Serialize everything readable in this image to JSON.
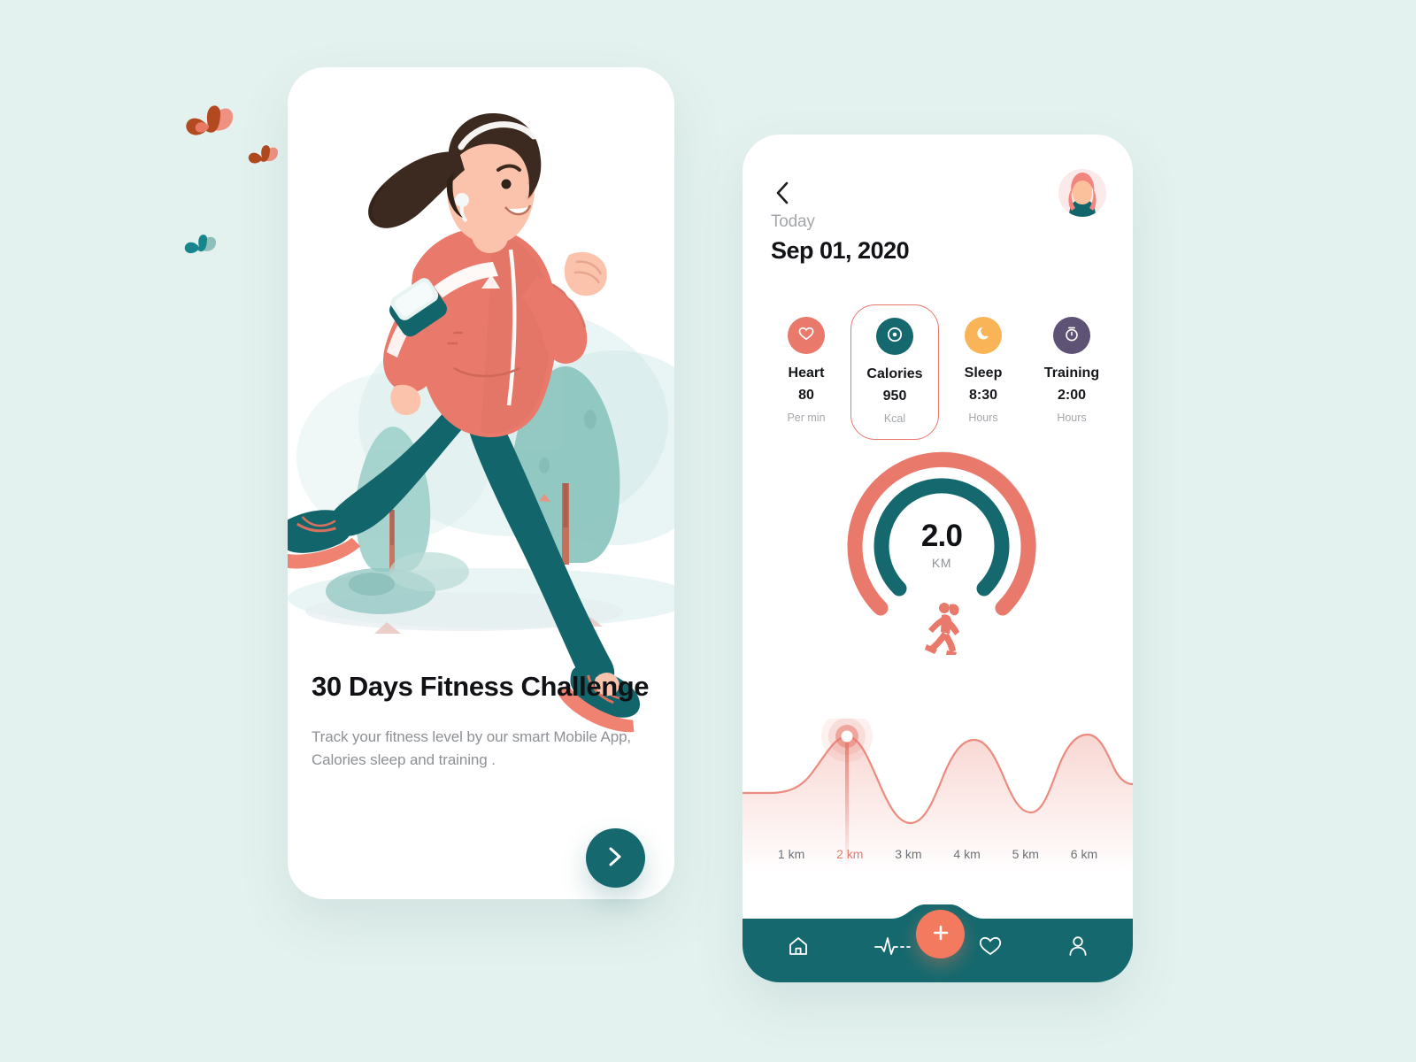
{
  "theme": {
    "bg": "#e4f2ef",
    "card_bg": "#ffffff",
    "teal": "#15696e",
    "coral": "#e8796b",
    "orange": "#f37a5e",
    "amber": "#f9b council",
    "muted": "#a3a7ac"
  },
  "onboarding": {
    "title": "30 Days Fitness Challenge",
    "description": "Track your fitness level by our smart Mobile App, Calories sleep and training .",
    "next_icon": "chevron-right-icon"
  },
  "dashboard": {
    "back_icon": "chevron-left-icon",
    "avatar_name": "user-avatar",
    "today_label": "Today",
    "date": "Sep 01, 2020",
    "stats": [
      {
        "icon": "heart-icon",
        "name": "Heart",
        "value": "80",
        "unit": "Per min",
        "color": "#e8796b",
        "active": false
      },
      {
        "icon": "target-icon",
        "name": "Calories",
        "value": "950",
        "unit": "Kcal",
        "color": "#15696e",
        "active": true
      },
      {
        "icon": "moon-icon",
        "name": "Sleep",
        "value": "8:30",
        "unit": "Hours",
        "color": "#f9b457",
        "active": false
      },
      {
        "icon": "stopwatch-icon",
        "name": "Training",
        "value": "2:00",
        "unit": "Hours",
        "color": "#5f5375",
        "active": false
      }
    ],
    "ring": {
      "value": "2.0",
      "unit": "KM",
      "runner_icon": "running-figure-icon"
    },
    "wave": {
      "marker_label": "2 km",
      "labels": [
        {
          "text": "1 km",
          "active": false
        },
        {
          "text": "2 km",
          "active": true
        },
        {
          "text": "3 km",
          "active": false
        },
        {
          "text": "4 km",
          "active": false
        },
        {
          "text": "5 km",
          "active": false
        },
        {
          "text": "6 km",
          "active": false
        }
      ]
    },
    "nav": [
      {
        "icon": "home-icon",
        "label": "Home"
      },
      {
        "icon": "pulse-icon",
        "label": "Activity"
      },
      {
        "icon": "plus-icon",
        "label": "Add"
      },
      {
        "icon": "heart-icon",
        "label": "Favorites"
      },
      {
        "icon": "person-icon",
        "label": "Profile"
      }
    ]
  },
  "chart_data": {
    "type": "area",
    "title": "",
    "xlabel": "",
    "ylabel": "",
    "categories": [
      "1 km",
      "2 km",
      "3 km",
      "4 km",
      "5 km",
      "6 km"
    ],
    "values": [
      0.3,
      0.92,
      0.05,
      0.8,
      0.18,
      0.78
    ],
    "highlight_index": 1,
    "highlight_value": "2 km",
    "grid": false,
    "legend": "none",
    "line_color": "#e8796b",
    "fill": "coral-gradient"
  }
}
